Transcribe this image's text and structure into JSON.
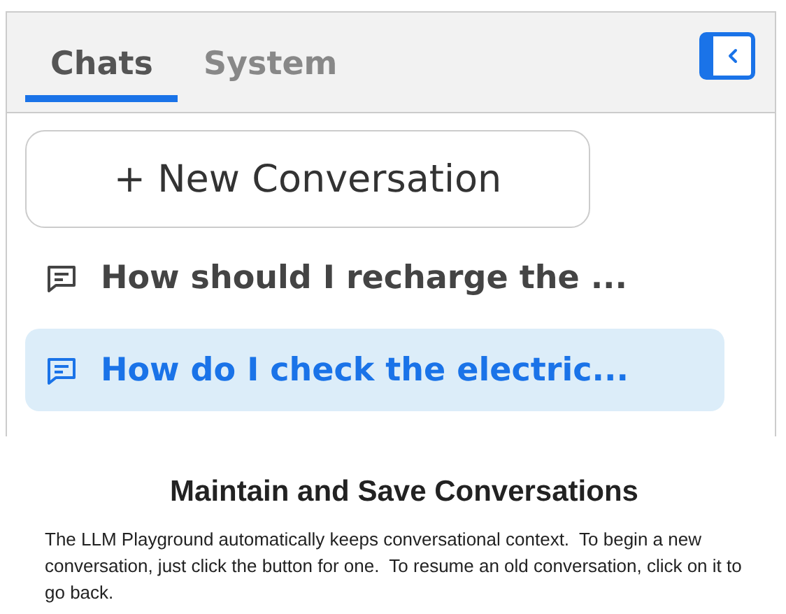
{
  "sidebar": {
    "tabs": [
      {
        "label": "Chats",
        "selected": true
      },
      {
        "label": "System",
        "selected": false
      }
    ],
    "new_button": {
      "label": "+ New Conversation"
    },
    "conversations": [
      {
        "title": "How should I recharge the ...",
        "selected": false
      },
      {
        "title": "How do I check the electric...",
        "selected": true
      }
    ]
  },
  "caption": {
    "title": "Maintain and Save Conversations",
    "text": "The LLM Playground automatically keeps conversational context.  To begin a new conversation, just click the button for one.  To resume an old conversation, click on it to go back."
  }
}
